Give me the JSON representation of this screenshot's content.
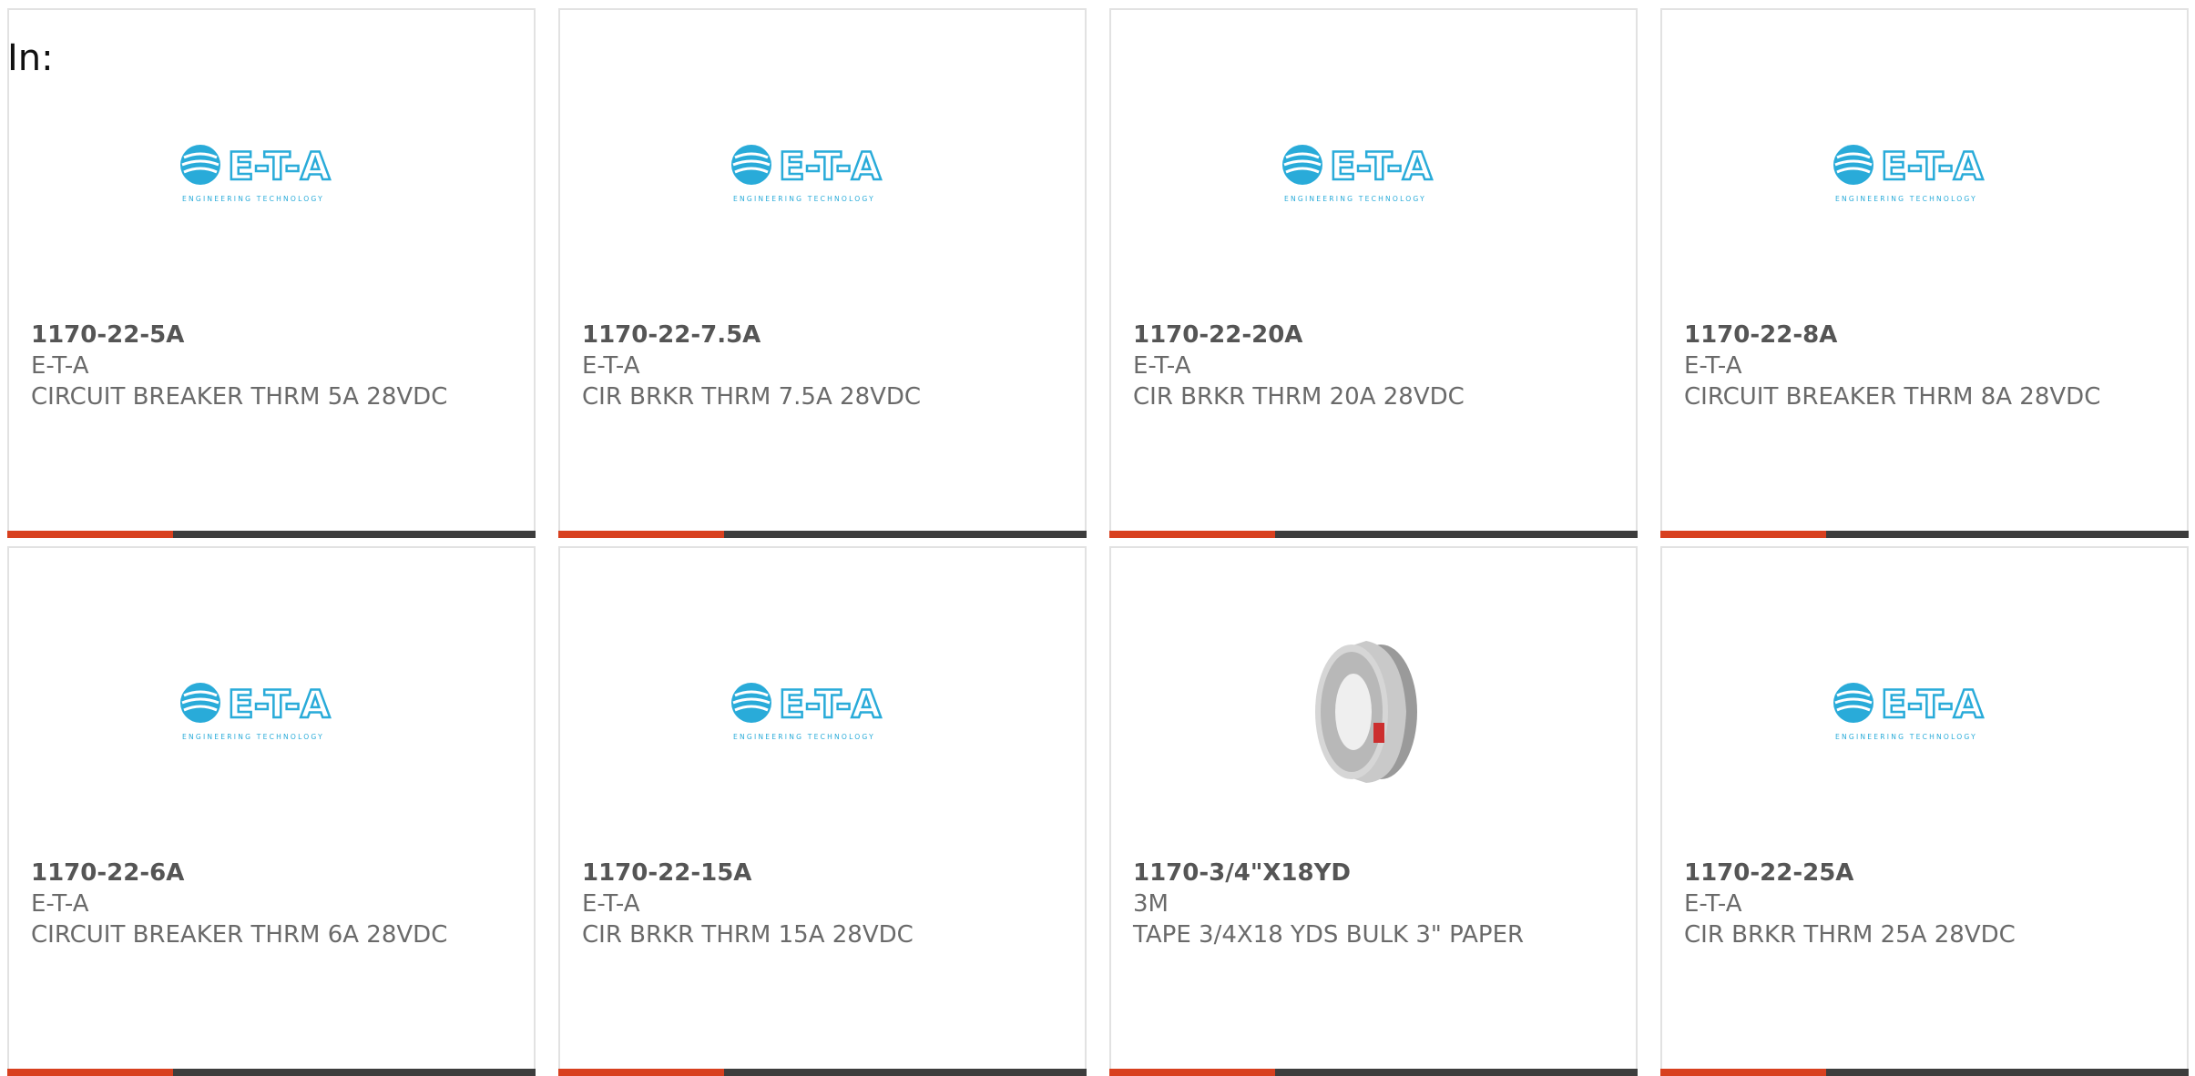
{
  "page": {
    "heading": "In:"
  },
  "colors": {
    "accent": "#d8401f",
    "bar_dark": "#3d3d3d",
    "card_border": "#e2e2e2",
    "logo_blue": "#29abd9"
  },
  "products": [
    {
      "part_number": "1170-22-5A",
      "manufacturer": "E-T-A",
      "description": "CIRCUIT BREAKER THRM 5A 28VDC",
      "image": "eta-logo",
      "logo_text": "E-T-A",
      "logo_tagline": "ENGINEERING TECHNOLOGY"
    },
    {
      "part_number": "1170-22-7.5A",
      "manufacturer": "E-T-A",
      "description": "CIR BRKR THRM 7.5A 28VDC",
      "image": "eta-logo",
      "logo_text": "E-T-A",
      "logo_tagline": "ENGINEERING TECHNOLOGY"
    },
    {
      "part_number": "1170-22-20A",
      "manufacturer": "E-T-A",
      "description": "CIR BRKR THRM 20A 28VDC",
      "image": "eta-logo",
      "logo_text": "E-T-A",
      "logo_tagline": "ENGINEERING TECHNOLOGY"
    },
    {
      "part_number": "1170-22-8A",
      "manufacturer": "E-T-A",
      "description": "CIRCUIT BREAKER THRM 8A 28VDC",
      "image": "eta-logo",
      "logo_text": "E-T-A",
      "logo_tagline": "ENGINEERING TECHNOLOGY"
    },
    {
      "part_number": "1170-22-6A",
      "manufacturer": "E-T-A",
      "description": "CIRCUIT BREAKER THRM 6A 28VDC",
      "image": "eta-logo",
      "logo_text": "E-T-A",
      "logo_tagline": "ENGINEERING TECHNOLOGY"
    },
    {
      "part_number": "1170-22-15A",
      "manufacturer": "E-T-A",
      "description": "CIR BRKR THRM 15A 28VDC",
      "image": "eta-logo",
      "logo_text": "E-T-A",
      "logo_tagline": "ENGINEERING TECHNOLOGY"
    },
    {
      "part_number": "1170-3/4\"X18YD",
      "manufacturer": "3M",
      "description": "TAPE 3/4X18 YDS BULK 3\" PAPER",
      "image": "tape-roll",
      "logo_text": "",
      "logo_tagline": ""
    },
    {
      "part_number": "1170-22-25A",
      "manufacturer": "E-T-A",
      "description": "CIR BRKR THRM 25A 28VDC",
      "image": "eta-logo",
      "logo_text": "E-T-A",
      "logo_tagline": "ENGINEERING TECHNOLOGY"
    }
  ]
}
